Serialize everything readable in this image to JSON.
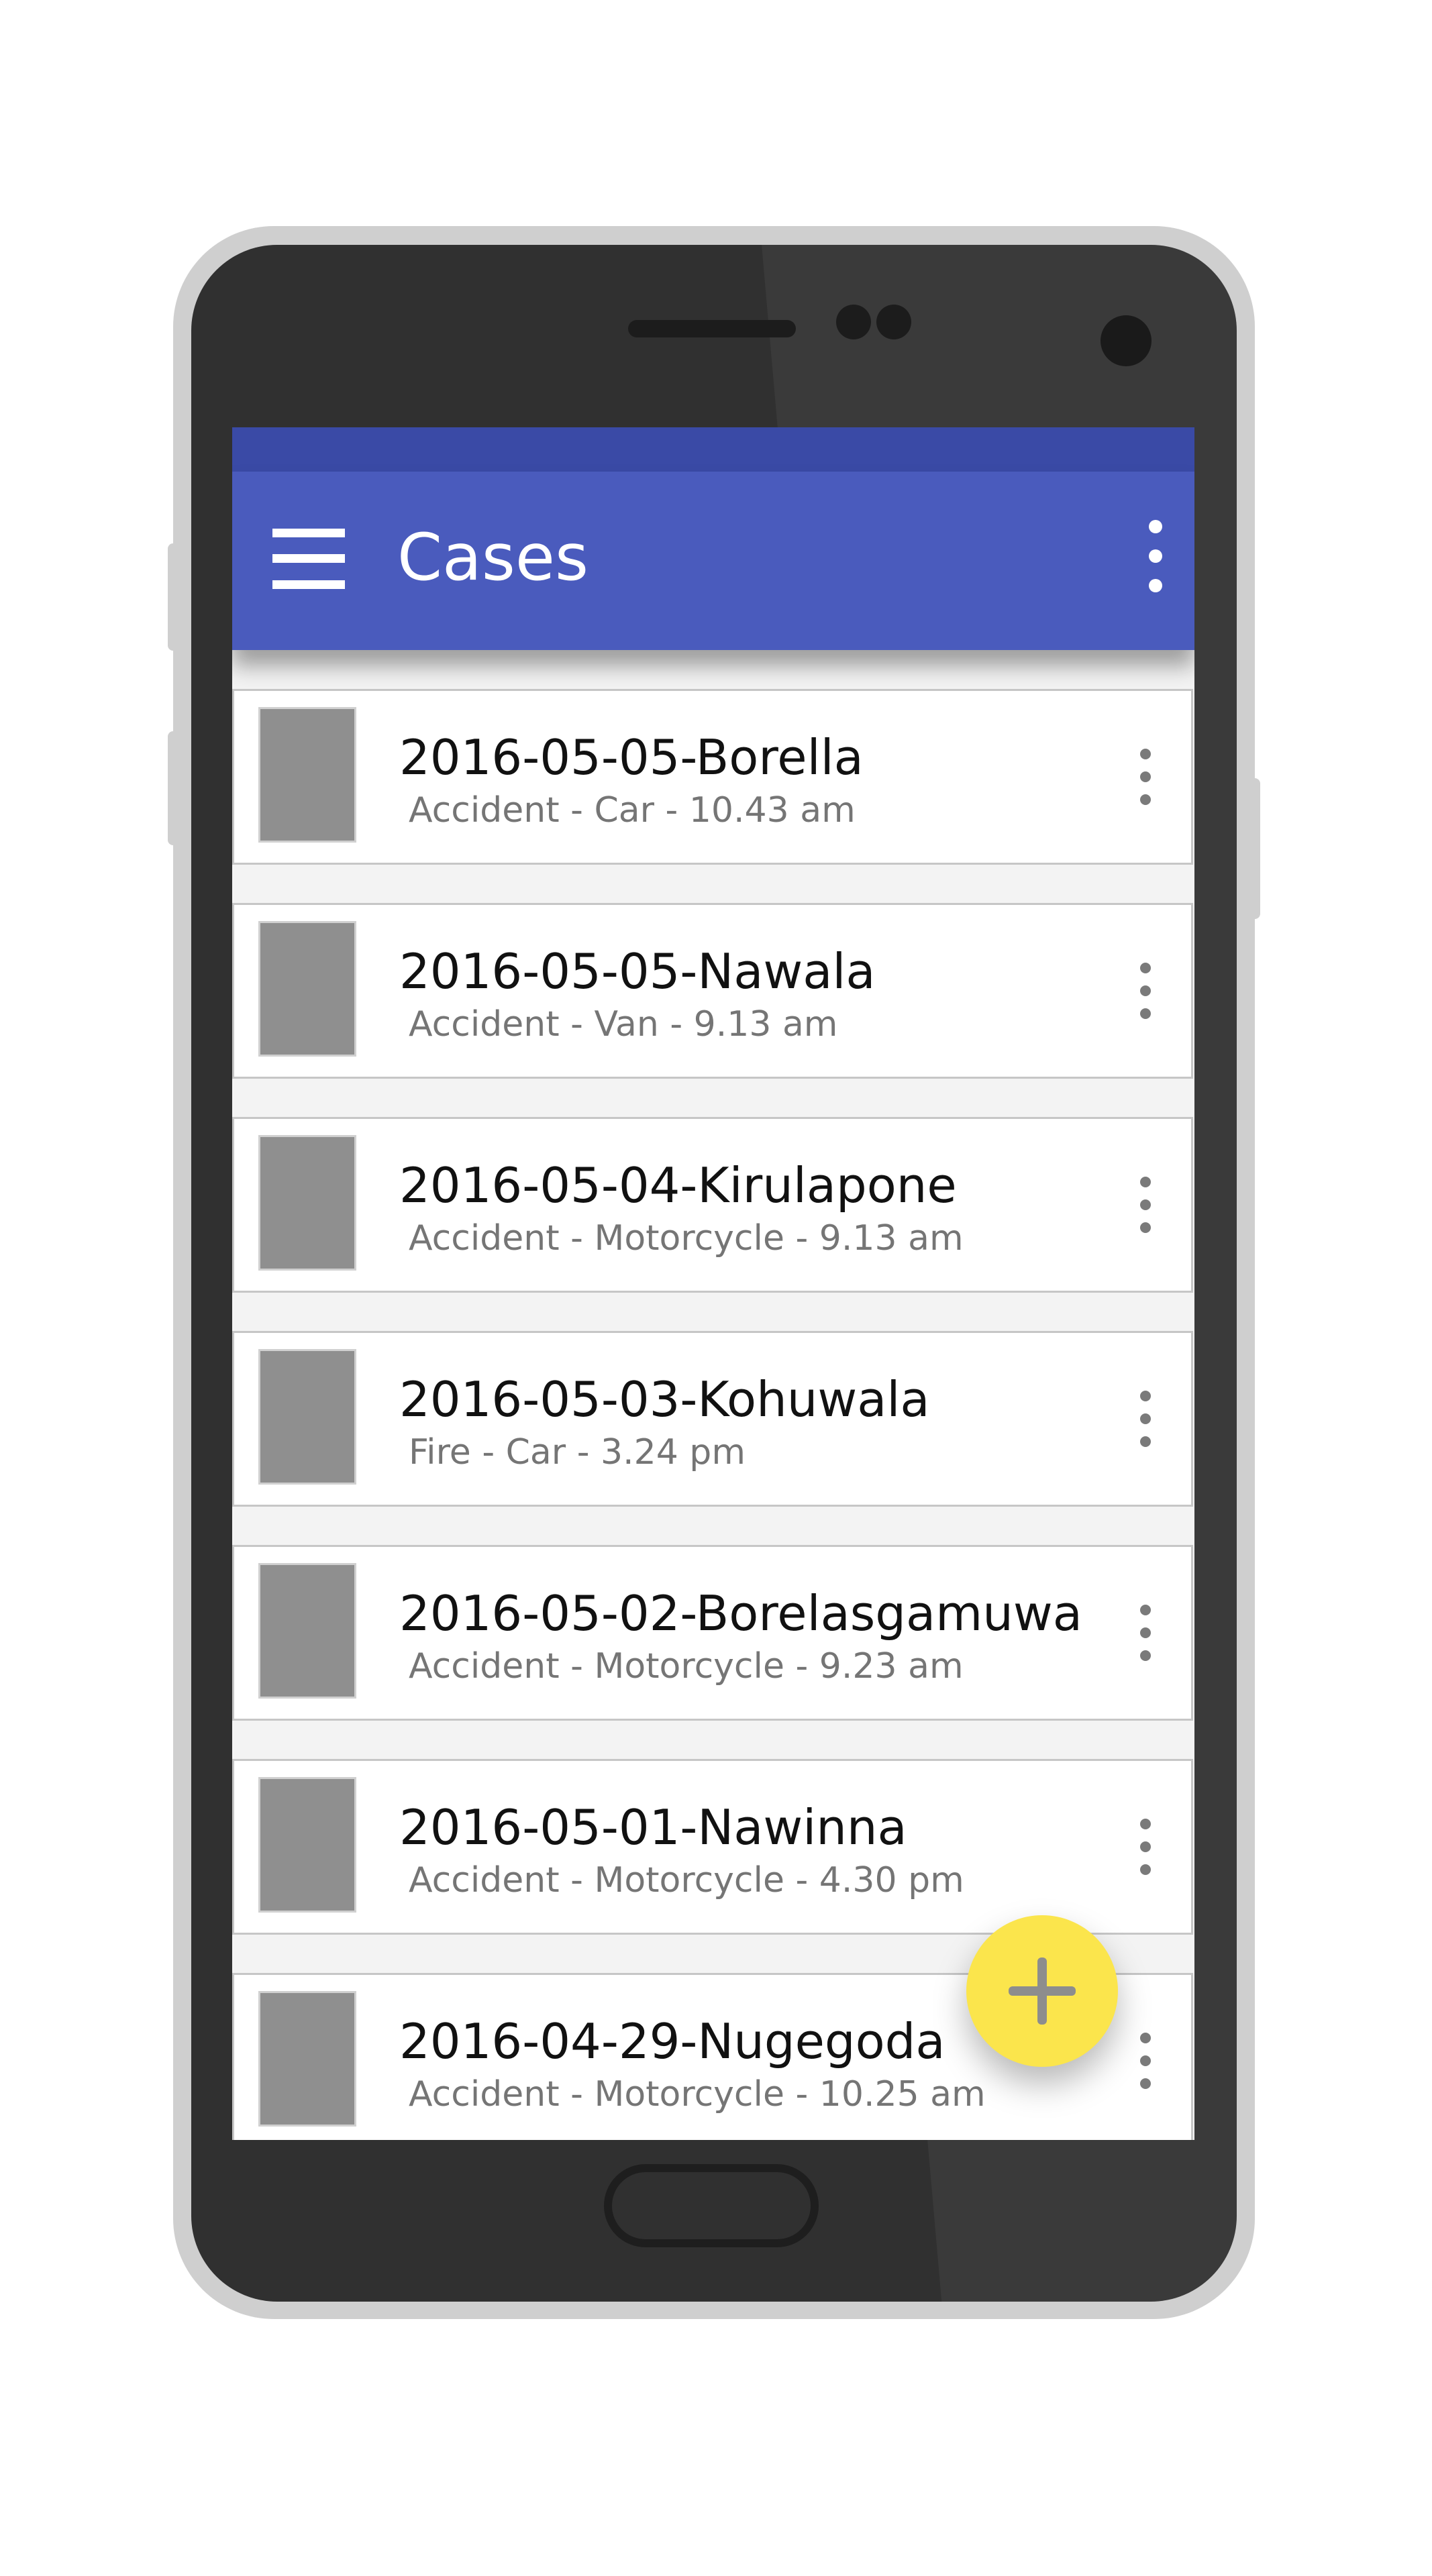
{
  "app_bar": {
    "title": "Cases",
    "menu_icon": "hamburger-menu-icon",
    "overflow_icon": "more-vertical-icon",
    "color": "#4a5bbd",
    "status_bar_color": "#3a4aa6"
  },
  "cases": [
    {
      "title": "2016-05-05-Borella",
      "subtitle": "Accident - Car - 10.43 am"
    },
    {
      "title": "2016-05-05-Nawala",
      "subtitle": "Accident - Van - 9.13 am"
    },
    {
      "title": "2016-05-04-Kirulapone",
      "subtitle": "Accident - Motorcycle - 9.13 am"
    },
    {
      "title": "2016-05-03-Kohuwala",
      "subtitle": "Fire - Car - 3.24 pm"
    },
    {
      "title": "2016-05-02-Borelasgamuwa",
      "subtitle": "Accident - Motorcycle - 9.23 am"
    },
    {
      "title": "2016-05-01-Nawinna",
      "subtitle": "Accident - Motorcycle - 4.30 pm"
    },
    {
      "title": "2016-04-29-Nugegoda",
      "subtitle": "Accident - Motorcycle - 10.25 am"
    }
  ],
  "fab": {
    "icon": "plus-icon",
    "color": "#fbe54c"
  }
}
